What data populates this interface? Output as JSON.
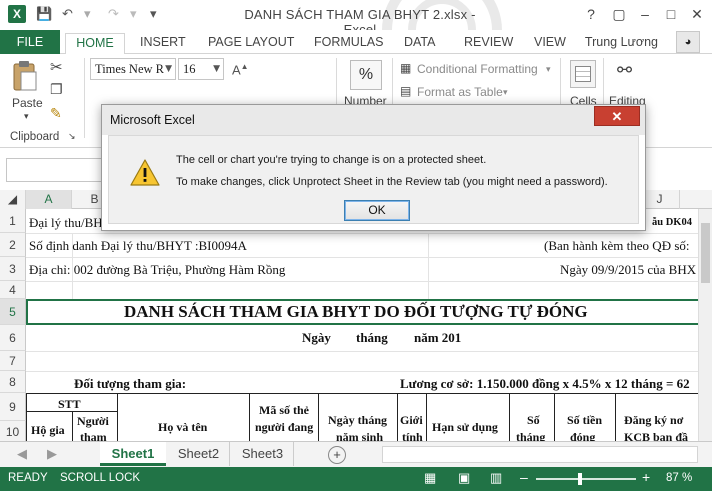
{
  "window": {
    "title": "DANH SÁCH THAM GIA BHYT 2.xlsx - Excel",
    "app_icon_letter": "X",
    "qat": {
      "save": "💾",
      "undo": "↶",
      "redo": "↷",
      "customize": "▾"
    },
    "controls": {
      "help": "?",
      "restore": "▢",
      "minimize": "–",
      "maximize": "□",
      "close": "✕"
    }
  },
  "ribbon": {
    "tabs": [
      "FILE",
      "HOME",
      "INSERT",
      "PAGE LAYOUT",
      "FORMULAS",
      "DATA",
      "REVIEW",
      "VIEW"
    ],
    "user": "Trung Lương",
    "clipboard": {
      "paste": "Paste",
      "group": "Clipboard"
    },
    "font": {
      "name": "Times New R",
      "size": "16"
    },
    "number": {
      "label": "Number",
      "symbol": "%"
    },
    "styles": {
      "conditional": "Conditional Formatting",
      "format_table": "Format as Table"
    },
    "cells": "Cells",
    "editing": "Editing"
  },
  "grid": {
    "columns": [
      "A",
      "B",
      "J"
    ],
    "rows": [
      "1",
      "2",
      "3",
      "4",
      "5",
      "6",
      "7",
      "8",
      "9",
      "10"
    ],
    "cells": {
      "r1a": "Đại lý thu/BH",
      "r1j": "ẫu DK04",
      "r2a": "Số định danh Đại lý thu/BHYT :BI0094A",
      "r2j": "(Ban hành kèm theo QĐ số:",
      "r3a": "Địa chỉ: 002 đường Bà Triệu, Phường Hàm Rồng",
      "r3j": "Ngày 09/9/2015 của BHX",
      "r5": "DANH SÁCH THAM GIA BHYT DO ĐỐI TƯỢNG TỰ ĐÓNG",
      "r6_ngay": "Ngày",
      "r6_thang": "tháng",
      "r6_nam": "năm 201",
      "r8a": "Đối tượng tham gia:",
      "r8j": "Lương cơ sở: 1.150.000 đồng x 4.5% x 12 tháng = 62",
      "h_stt": "STT",
      "h_hogia": "Hộ gia",
      "h_nguoi": "Người",
      "h_tham": "tham",
      "h_hoten": "Họ và tên",
      "h_maso1": "Mã số thẻ",
      "h_maso2": "người đang",
      "h_ngay1": "Ngày tháng",
      "h_ngay2": "năm sinh",
      "h_gioi1": "Giới",
      "h_gioi2": "tính",
      "h_han": "Hạn sử dụng",
      "h_so1": "Số",
      "h_so2": "tháng",
      "h_tien1": "Số tiền",
      "h_tien2": "đóng",
      "h_dk1": "Đăng ký nơ",
      "h_dk2": "KCB ban đầ"
    }
  },
  "sheets": {
    "tabs": [
      "Sheet1",
      "Sheet2",
      "Sheet3"
    ],
    "add": "+"
  },
  "status": {
    "ready": "READY",
    "scroll_lock": "SCROLL LOCK",
    "zoom": "87 %",
    "zoom_minus": "–",
    "zoom_plus": "+"
  },
  "dialog": {
    "title": "Microsoft Excel",
    "close": "✕",
    "line1": "The cell or chart you're trying to change is on a protected sheet.",
    "line2": "To make changes, click Unprotect Sheet in the Review tab (you might need a password).",
    "ok": "OK"
  },
  "colors": {
    "excel_green": "#217346",
    "dialog_close": "#c84031",
    "ok_border": "#3c7fb1"
  }
}
